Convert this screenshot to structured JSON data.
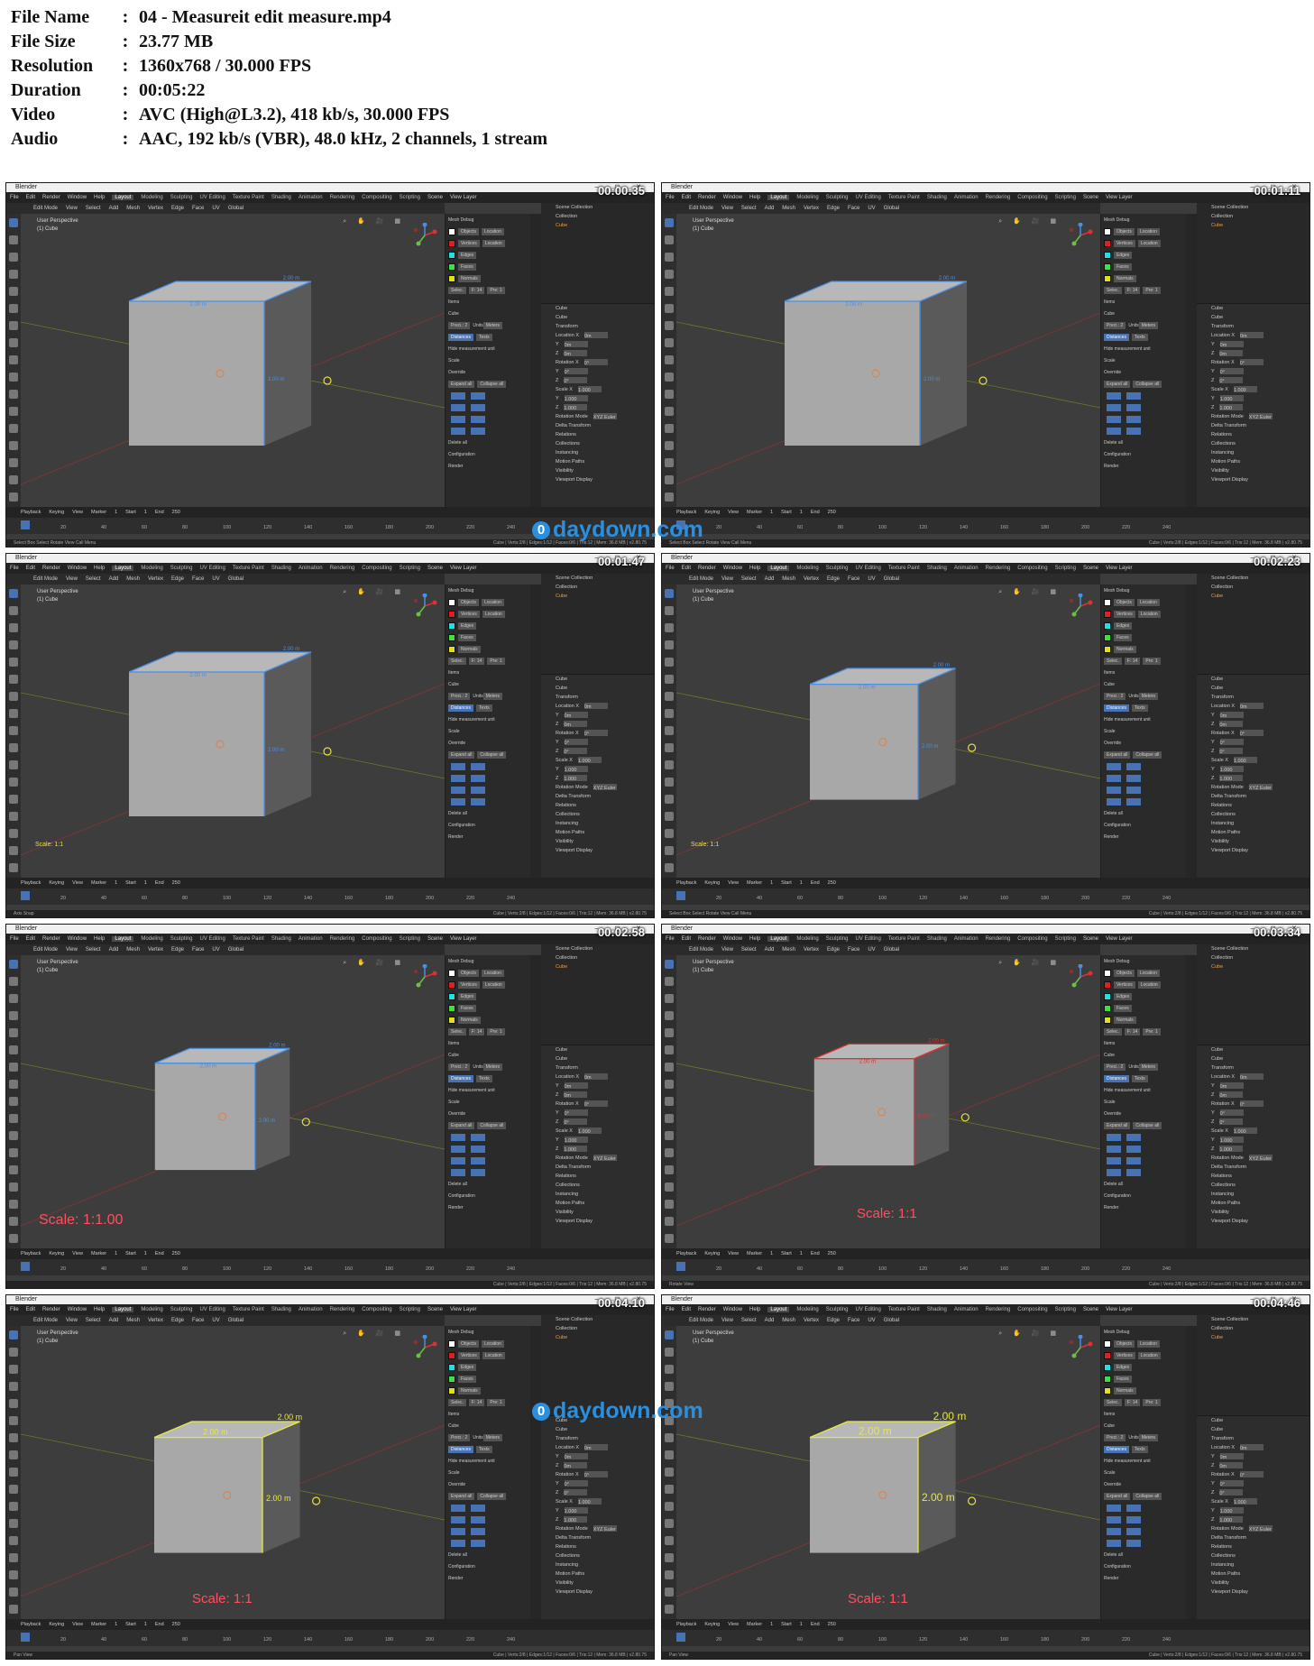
{
  "file_info": [
    {
      "key": "File Name",
      "value": "04 - Measureit edit measure.mp4"
    },
    {
      "key": "File Size",
      "value": "23.77 MB"
    },
    {
      "key": "Resolution",
      "value": "1360x768 / 30.000 FPS"
    },
    {
      "key": "Duration",
      "value": "00:05:22"
    },
    {
      "key": "Video",
      "value": "AVC (High@L3.2), 418 kb/s, 30.000 FPS"
    },
    {
      "key": "Audio",
      "value": "AAC, 192 kb/s (VBR), 48.0 kHz, 2 channels, 1 stream"
    }
  ],
  "separator": ":",
  "blender": {
    "window_title": "Blender",
    "window_controls": "– ◻ ✕",
    "menus": [
      "File",
      "Edit",
      "Render",
      "Window",
      "Help"
    ],
    "workspaces": [
      "Layout",
      "Modeling",
      "Sculpting",
      "UV Editing",
      "Texture Paint",
      "Shading",
      "Animation",
      "Rendering",
      "Compositing",
      "Scripting"
    ],
    "active_workspace": "Layout",
    "scene_label": "Scene",
    "view_layer_label": "View Layer",
    "mode": "Edit Mode",
    "view_menus": [
      "View",
      "Select",
      "Add",
      "Mesh",
      "Vertex",
      "Edge",
      "Face",
      "UV"
    ],
    "transform_orientation": "Global",
    "viewport_info": [
      "User Perspective",
      "(1) Cube"
    ],
    "mesh_debug": {
      "title": "Mesh Debug",
      "rows": [
        {
          "name": "Objects",
          "extra": "Location"
        },
        {
          "name": "Vertices",
          "extra": "Location"
        },
        {
          "name": "Edges",
          "extra": ""
        },
        {
          "name": "Faces",
          "extra": ""
        },
        {
          "name": "Normals",
          "extra": ""
        }
      ],
      "selec": "Selec.",
      "f_val": "F: 14",
      "pre_val": "Pre: 1",
      "items": "Items",
      "object": "Cube",
      "precision": "Preci.: 2",
      "units": "Units",
      "units_value": "Meters",
      "distances": "Distances",
      "texts": "Texts",
      "hide_unit": "Hide measurement unit",
      "scale": "Scale",
      "override": "Override",
      "expand_all": "Expand all",
      "collapse_all": "Collapse all",
      "delete_all": "Delete all",
      "configuration": "Configuration",
      "render": "Render"
    },
    "outliner": {
      "title": "Scene Collection",
      "collection": "Collection",
      "object": "Cube"
    },
    "properties": {
      "object": "Cube",
      "transform": "Transform",
      "location": [
        {
          "label": "Location X",
          "value": "0m"
        },
        {
          "label": "Y",
          "value": "0m"
        },
        {
          "label": "Z",
          "value": "0m"
        }
      ],
      "rotation": [
        {
          "label": "Rotation X",
          "value": "0°"
        },
        {
          "label": "Y",
          "value": "0°"
        },
        {
          "label": "Z",
          "value": "0°"
        }
      ],
      "scale": [
        {
          "label": "Scale X",
          "value": "1.000"
        },
        {
          "label": "Y",
          "value": "1.000"
        },
        {
          "label": "Z",
          "value": "1.000"
        }
      ],
      "rotation_mode_label": "Rotation Mode",
      "rotation_mode": "XYZ Euler",
      "sections": [
        "Delta Transform",
        "Relations",
        "Collections",
        "Instancing",
        "Motion Paths",
        "Visibility",
        "Viewport Display"
      ]
    },
    "timeline": {
      "items": [
        "Playback",
        "Keying",
        "View",
        "Marker"
      ],
      "frame": "1",
      "start_label": "Start",
      "start": "1",
      "end_label": "End",
      "end": "250",
      "ruler": [
        "20",
        "40",
        "60",
        "80",
        "100",
        "120",
        "140",
        "160",
        "180",
        "200",
        "220",
        "240"
      ]
    },
    "status_right": "Cube | Verts:2/8 | Edges:1/12 | Faces:0/6 | Tris:12 | Mem: 36.8 MB | v2.80.75"
  },
  "frames": [
    {
      "timecode": "00:00:35",
      "status_left": "Select    Box Select    Rotate View    Call Menu",
      "scale_text": "",
      "size_label": "2.00 m"
    },
    {
      "timecode": "00:01:11",
      "status_left": "Select    Box Select    Rotate View    Call Menu",
      "scale_text": "",
      "size_label": "2.00 m"
    },
    {
      "timecode": "00:01:47",
      "status_left": "Axis Snap",
      "scale_text": "Scale: 1:1",
      "size_label": "2.00 m"
    },
    {
      "timecode": "00:02:23",
      "status_left": "Select    Box Select    Rotate View    Call Menu",
      "scale_text": "Scale: 1:1",
      "size_label": "2.00 m"
    },
    {
      "timecode": "00:02:58",
      "status_left": "",
      "scale_text": "Scale: 1:1.00",
      "size_label": "2.00 m"
    },
    {
      "timecode": "00:03:34",
      "status_left": "Rotate View",
      "scale_text": "Scale: 1:1",
      "size_label": "2.00 m"
    },
    {
      "timecode": "00:04:10",
      "status_left": "Pan View",
      "scale_text": "Scale: 1:1",
      "size_label": "2.00 m"
    },
    {
      "timecode": "00:04:46",
      "status_left": "Pan View",
      "scale_text": "Scale: 1:1",
      "size_label": "2.00 m"
    }
  ],
  "watermark": {
    "icon": "0",
    "text": "daydown.com"
  },
  "colors": {
    "ui_bg": "#3c3c3c",
    "accent_blue": "#4772b3",
    "edge_blue": "#4a90e2",
    "edge_red": "#e03030",
    "edge_yellow": "#e8e840",
    "scale_red": "#ff5060",
    "scale_yellow": "#e8e830",
    "watermark": "#2b8fe0",
    "swatches": [
      "#ffffff",
      "#e02020",
      "#20e0e0",
      "#40e040",
      "#e0e020"
    ]
  }
}
